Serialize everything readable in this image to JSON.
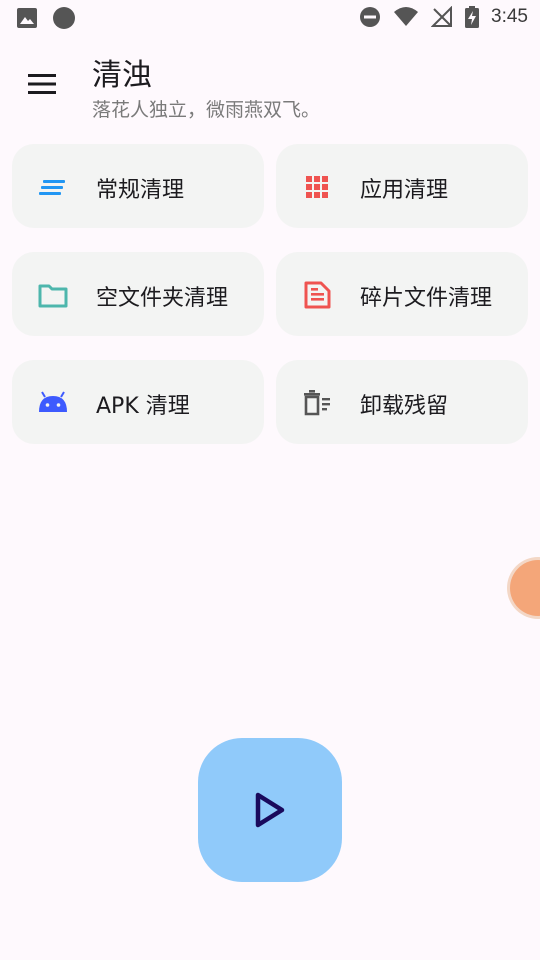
{
  "status_bar": {
    "time": "3:45",
    "icons": [
      "image-icon",
      "circle-icon",
      "dnd-icon",
      "wifi-icon",
      "no-signal-icon",
      "battery-charging-icon"
    ]
  },
  "header": {
    "title": "清浊",
    "subtitle": "落花人独立，微雨燕双飞。"
  },
  "cards": [
    {
      "label": "常规清理",
      "icon": "lines-icon",
      "color": "#2196f3"
    },
    {
      "label": "应用清理",
      "icon": "grid-icon",
      "color": "#ef5350"
    },
    {
      "label": "空文件夹清理",
      "icon": "folder-icon",
      "color": "#4db6ac"
    },
    {
      "label": "碎片文件清理",
      "icon": "document-icon",
      "color": "#ef5350"
    },
    {
      "label": "APK 清理",
      "icon": "android-icon",
      "color": "#3d5afe"
    },
    {
      "label": "卸载残留",
      "icon": "trash-icon",
      "color": "#555555"
    }
  ],
  "fab": {
    "icon": "play-icon",
    "background": "#90caf9",
    "icon_color": "#1a0a5c"
  }
}
